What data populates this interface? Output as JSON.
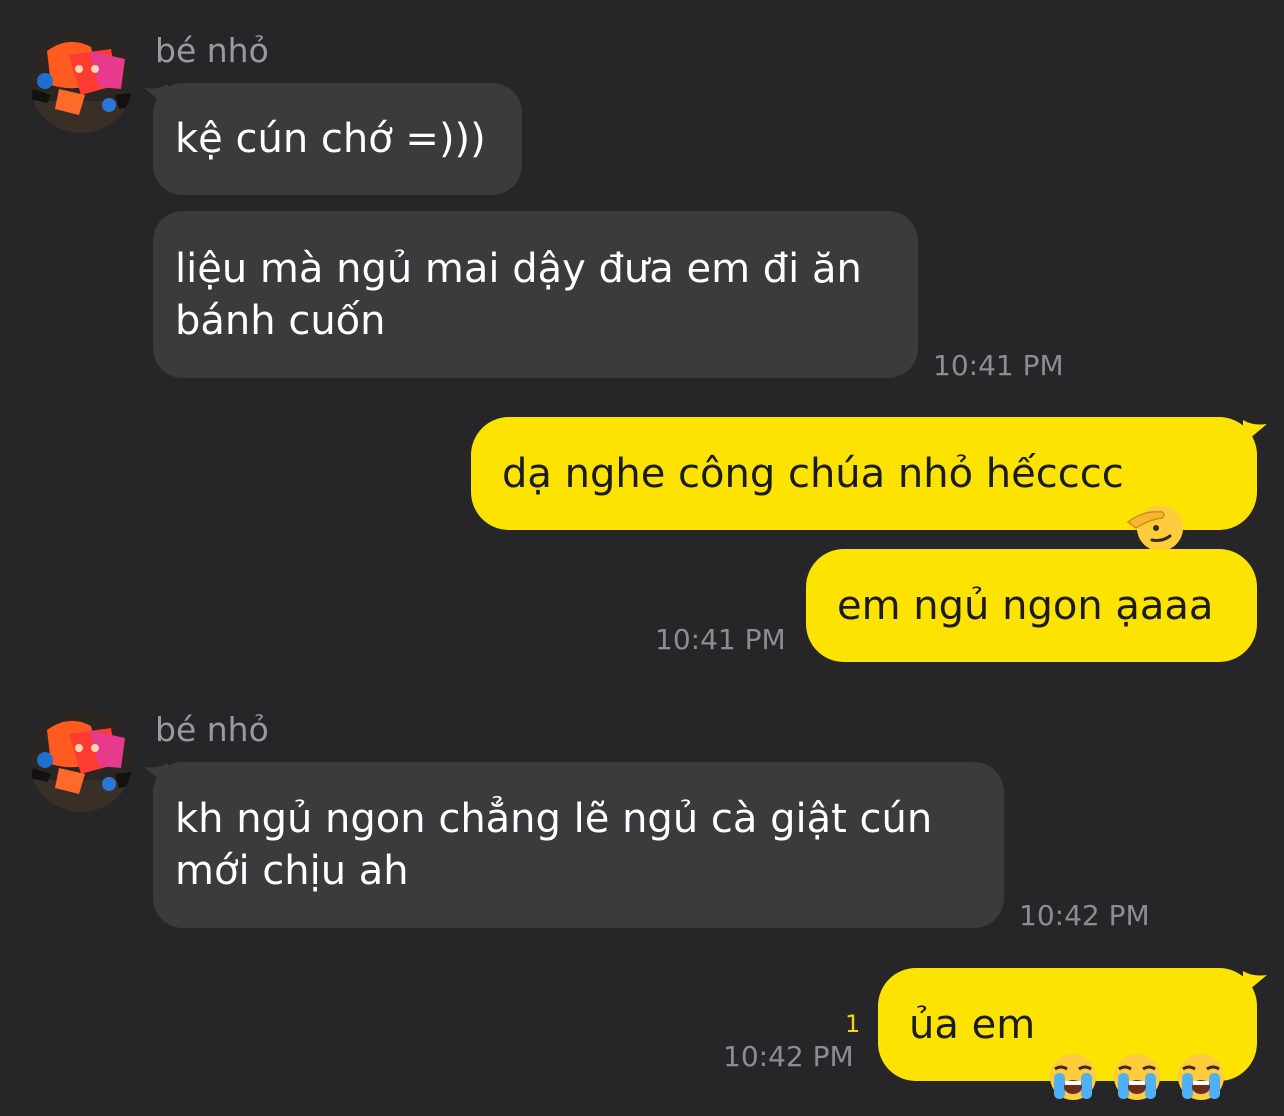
{
  "theme": {
    "background": "#262629",
    "received_bubble": "#3b3b3e",
    "sent_bubble": "#fce301",
    "unread_color": "#f3d50d"
  },
  "messages": {
    "group1": {
      "sender": "bé nhỏ",
      "bubbles": [
        "kệ cún chớ =)))",
        "liệu mà ngủ mai dậy đưa em đi ăn\nbánh cuốn"
      ],
      "time": "10:41 PM"
    },
    "group2": {
      "bubbles": [
        "dạ nghe công chúa nhỏ hếcccc",
        "em ngủ ngon ạaaa"
      ],
      "emoji": "saluting-face-emoji",
      "time": "10:41 PM"
    },
    "group3": {
      "sender": "bé nhỏ",
      "bubbles": [
        "kh ngủ ngon chẳng lẽ ngủ cà giật cún\nmới chịu ah"
      ],
      "time": "10:42 PM"
    },
    "group4": {
      "bubbles": [
        "ủa em"
      ],
      "emoji": [
        "loudly-crying-face-emoji",
        "loudly-crying-face-emoji",
        "loudly-crying-face-emoji"
      ],
      "unread_count": "1",
      "time": "10:42 PM"
    }
  }
}
